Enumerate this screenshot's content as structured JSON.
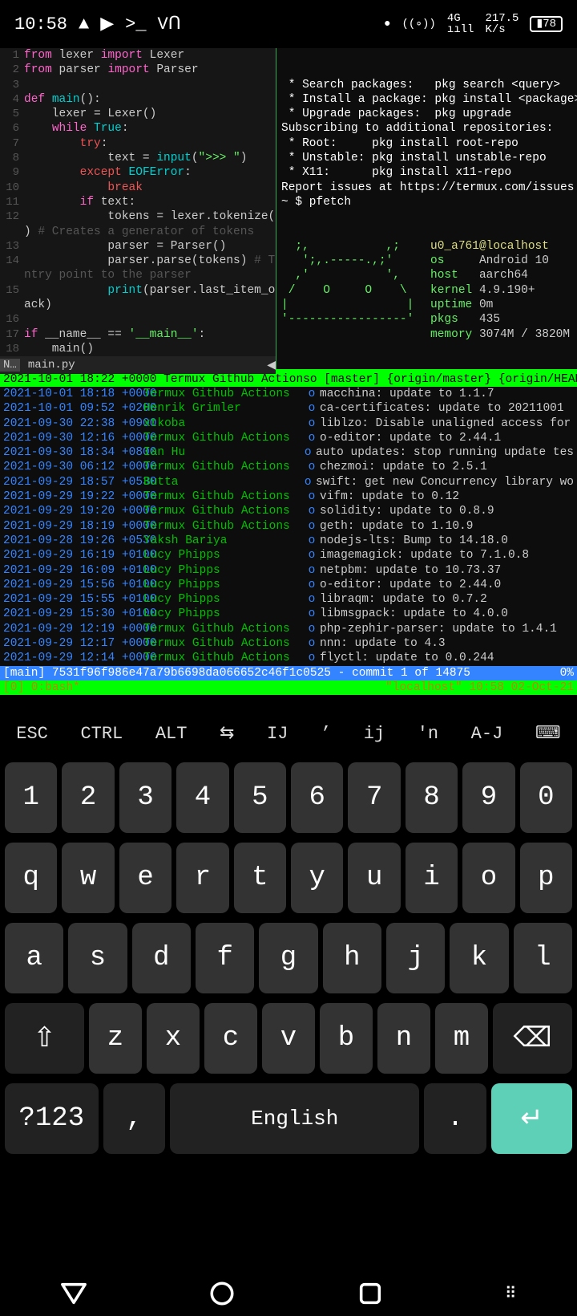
{
  "status": {
    "time": "10:58",
    "battery": "78",
    "net": "4G",
    "speed": "217.5\nK/s"
  },
  "editor": {
    "tab_indicator": "N…",
    "tab_file": "main.py",
    "lines": [
      {
        "n": "1",
        "pre": "",
        "html": "<span class='kw-pink'>from</span> lexer <span class='kw-pink'>import</span> Lexer"
      },
      {
        "n": "2",
        "pre": "",
        "html": "<span class='kw-pink'>from</span> parser <span class='kw-pink'>import</span> Parser"
      },
      {
        "n": "3",
        "pre": "",
        "html": ""
      },
      {
        "n": "4",
        "pre": "",
        "html": "<span class='kw-pink'>def</span> <span class='kw-teal'>main</span>():"
      },
      {
        "n": "5",
        "pre": "    ",
        "html": "lexer = Lexer()"
      },
      {
        "n": "6",
        "pre": "    ",
        "html": "<span class='kw-pink'>while</span> <span class='kw-teal'>True</span>:"
      },
      {
        "n": "7",
        "pre": "        ",
        "html": "<span class='kw-red'>try</span>:"
      },
      {
        "n": "8",
        "pre": "            ",
        "html": "text = <span class='kw-teal'>input</span>(<span class='kw-green'>\">>> \"</span>)"
      },
      {
        "n": "9",
        "pre": "        ",
        "html": "<span class='kw-red'>except</span> <span class='kw-teal'>EOFError</span>:"
      },
      {
        "n": "10",
        "pre": "            ",
        "html": "<span class='kw-red'>break</span>"
      },
      {
        "n": "11",
        "pre": "        ",
        "html": "<span class='kw-pink'>if</span> text:"
      },
      {
        "n": "12",
        "pre": "            ",
        "html": "tokens = lexer.tokenize(text"
      },
      {
        "n": "",
        "pre": "",
        "html": ") <span class='cmt'># Creates a generator of tokens</span>"
      },
      {
        "n": "13",
        "pre": "            ",
        "html": "parser = Parser()"
      },
      {
        "n": "14",
        "pre": "            ",
        "html": "parser.parse(tokens) <span class='cmt'># The e</span>"
      },
      {
        "n": "",
        "pre": "",
        "html": "<span class='cmt'>ntry point to the parser</span>"
      },
      {
        "n": "15",
        "pre": "            ",
        "html": "<span class='kw-teal'>print</span>(parser.last_item_on_st"
      },
      {
        "n": "",
        "pre": "",
        "html": "ack)"
      },
      {
        "n": "16",
        "pre": "",
        "html": ""
      },
      {
        "n": "17",
        "pre": "",
        "html": "<span class='kw-pink'>if</span> __name__ == <span class='kw-green'>'__main__'</span>:"
      },
      {
        "n": "18",
        "pre": "    ",
        "html": "main()"
      }
    ]
  },
  "right": {
    "lines": [
      " * Search packages:   pkg search <query>",
      " * Install a package: pkg install <package>",
      " * Upgrade packages:  pkg upgrade",
      "",
      "Subscribing to additional repositories:",
      "",
      " * Root:     pkg install root-repo",
      " * Unstable: pkg install unstable-repo",
      " * X11:      pkg install x11-repo",
      "",
      "Report issues at https://termux.com/issues",
      "",
      "~ $ pfetch"
    ],
    "ascii": [
      "  ;,           ,;   ",
      "   ';,.-----.,;'    ",
      "  ,'           ',   ",
      " /    O     O    \\  ",
      "|                 | ",
      "'-----------------' "
    ],
    "info": [
      {
        "k": "",
        "v": "u0_a761@localhost",
        "usr": true
      },
      {
        "k": "os",
        "v": "Android 10"
      },
      {
        "k": "host",
        "v": "aarch64"
      },
      {
        "k": "kernel",
        "v": "4.9.190+"
      },
      {
        "k": "uptime",
        "v": "0m"
      },
      {
        "k": "pkgs",
        "v": "435"
      },
      {
        "k": "memory",
        "v": "3074M / 3820M"
      }
    ],
    "prompt": "~ $ "
  },
  "git": {
    "header_left": "2021-10-01 18:22 +0000 Termux Github Actions",
    "header_right": "o [master] {origin/master} {origin/HEAD",
    "rows": [
      {
        "d": "2021-10-01 18:18 +0000",
        "a": "Termux Github Actions",
        "m": "macchina: update to 1.1.7"
      },
      {
        "d": "2021-10-01 09:52 +0200",
        "a": "Henrik Grimler",
        "m": "ca-certificates: update to 20211001"
      },
      {
        "d": "2021-09-30 22:38 +0900",
        "a": "xtkoba",
        "m": "liblzo: Disable unaligned access for"
      },
      {
        "d": "2021-09-30 12:16 +0000",
        "a": "Termux Github Actions",
        "m": "o-editor: update to 2.44.1"
      },
      {
        "d": "2021-09-30 18:34 +0800",
        "a": "Ian Hu",
        "m": "auto updates: stop running update tes"
      },
      {
        "d": "2021-09-30 06:12 +0000",
        "a": "Termux Github Actions",
        "m": "chezmoi: update to 2.5.1"
      },
      {
        "d": "2021-09-29 18:57 +0530",
        "a": "Butta",
        "m": "swift: get new Concurrency library wo"
      },
      {
        "d": "2021-09-29 19:22 +0000",
        "a": "Termux Github Actions",
        "m": "vifm: update to 0.12"
      },
      {
        "d": "2021-09-29 19:20 +0000",
        "a": "Termux Github Actions",
        "m": "solidity: update to 0.8.9"
      },
      {
        "d": "2021-09-29 18:19 +0000",
        "a": "Termux Github Actions",
        "m": "geth: update to 1.10.9"
      },
      {
        "d": "2021-09-28 19:26 +0530",
        "a": "Yaksh Bariya",
        "m": "nodejs-lts: Bump to 14.18.0"
      },
      {
        "d": "2021-09-29 16:19 +0100",
        "a": "Lucy Phipps",
        "m": "imagemagick: update to 7.1.0.8"
      },
      {
        "d": "2021-09-29 16:09 +0100",
        "a": "Lucy Phipps",
        "m": "netpbm: update to 10.73.37"
      },
      {
        "d": "2021-09-29 15:56 +0100",
        "a": "Lucy Phipps",
        "m": "o-editor: update to 2.44.0"
      },
      {
        "d": "2021-09-29 15:55 +0100",
        "a": "Lucy Phipps",
        "m": "libraqm: update to 0.7.2"
      },
      {
        "d": "2021-09-29 15:30 +0100",
        "a": "Lucy Phipps",
        "m": "libmsgpack: update to 4.0.0"
      },
      {
        "d": "2021-09-29 12:19 +0000",
        "a": "Termux Github Actions",
        "m": "php-zephir-parser: update to 1.4.1"
      },
      {
        "d": "2021-09-29 12:17 +0000",
        "a": "Termux Github Actions",
        "m": "nnn: update to 4.3"
      },
      {
        "d": "2021-09-29 12:14 +0000",
        "a": "Termux Github Actions",
        "m": "flyctl: update to 0.0.244"
      }
    ],
    "commit_bar_left": "[main] 7531f96f986e47a79b6698da066652c46f1c0525 - commit 1 of 14875",
    "commit_bar_right": "0%"
  },
  "tmux": {
    "left": "[0] 0:bash*",
    "right": "\"localhost\" 10:58 02-Oct-21"
  },
  "extrakeys": [
    "ESC",
    "CTRL",
    "ALT",
    "⇆",
    "IJ",
    "’",
    "ij",
    "'n",
    "A-J",
    "⌨"
  ],
  "keyboard": {
    "r1": [
      "1",
      "2",
      "3",
      "4",
      "5",
      "6",
      "7",
      "8",
      "9",
      "0"
    ],
    "r2": [
      "q",
      "w",
      "e",
      "r",
      "t",
      "y",
      "u",
      "i",
      "o",
      "p"
    ],
    "r3": [
      "a",
      "s",
      "d",
      "f",
      "g",
      "h",
      "j",
      "k",
      "l"
    ],
    "r4": [
      "⇧",
      "z",
      "x",
      "c",
      "v",
      "b",
      "n",
      "m",
      "⌫"
    ],
    "r5": {
      "sym": "?123",
      "comma": ",",
      "space": "English",
      "dot": ".",
      "enter": "↵"
    }
  }
}
